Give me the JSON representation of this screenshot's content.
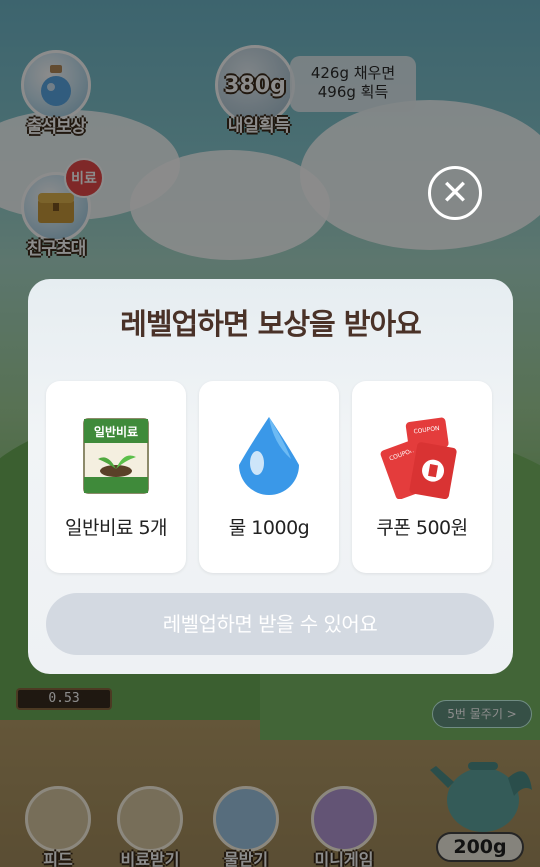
{
  "hud": {
    "attendance_label": "출석보상",
    "invite_label": "친구초대",
    "invite_badge": "비료",
    "tomorrow_amount": "380g",
    "tomorrow_label": "내일획득",
    "tomorrow_info_line1": "426g 채우면",
    "tomorrow_info_line2": "496g 획득"
  },
  "meter_value": "0.53",
  "water_hint": "5번 물주기 >",
  "water_amount": "200g",
  "bottom_nav": [
    {
      "label": "피드"
    },
    {
      "label": "비료받기"
    },
    {
      "label": "물받기"
    },
    {
      "label": "미니게임"
    }
  ],
  "modal": {
    "title": "레벨업하면 보상을 받아요",
    "rewards": [
      {
        "name": "일반비료 5개",
        "icon": "fertilizer-bag-icon",
        "bag_label": "일반비료"
      },
      {
        "name": "물 1000g",
        "icon": "water-drop-icon"
      },
      {
        "name": "쿠폰 500원",
        "icon": "coupon-icon",
        "coupon_text": "COUPON"
      }
    ],
    "cta_label": "레벨업하면 받을 수 있어요"
  },
  "colors": {
    "title": "#4a3228",
    "cta_bg": "#d3d9e1",
    "coupon_red": "#e43c3c",
    "drop_blue": "#3a98e8",
    "bag_green": "#3f8a3a"
  }
}
